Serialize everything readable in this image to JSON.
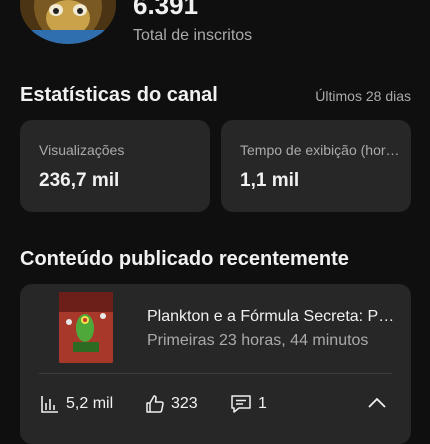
{
  "channel": {
    "subscriber_count": "6.391",
    "subscriber_label": "Total de inscritos"
  },
  "stats": {
    "title": "Estatísticas do canal",
    "period": "Últimos 28 dias",
    "cards": [
      {
        "label": "Visualizações",
        "value": "236,7 mil"
      },
      {
        "label": "Tempo de exibição (horas)",
        "value": "1,1 mil"
      }
    ]
  },
  "recent": {
    "title": "Conteúdo publicado recentemente",
    "video": {
      "title": "Plankton e a Fórmula Secreta: Plankton e a Fórmula Secreta",
      "meta": "Primeiras 23 horas, 44 minutos",
      "views": "5,2 mil",
      "likes": "323",
      "comments": "1"
    }
  },
  "icons": {
    "views": "bar-chart-icon",
    "likes": "thumbs-up-icon",
    "comments": "comment-icon",
    "collapse": "chevron-up-icon"
  },
  "colors": {
    "background": "#0f0f0f",
    "card": "#272727",
    "text_primary": "#f1f1f1",
    "text_secondary": "#aaaaaa"
  }
}
